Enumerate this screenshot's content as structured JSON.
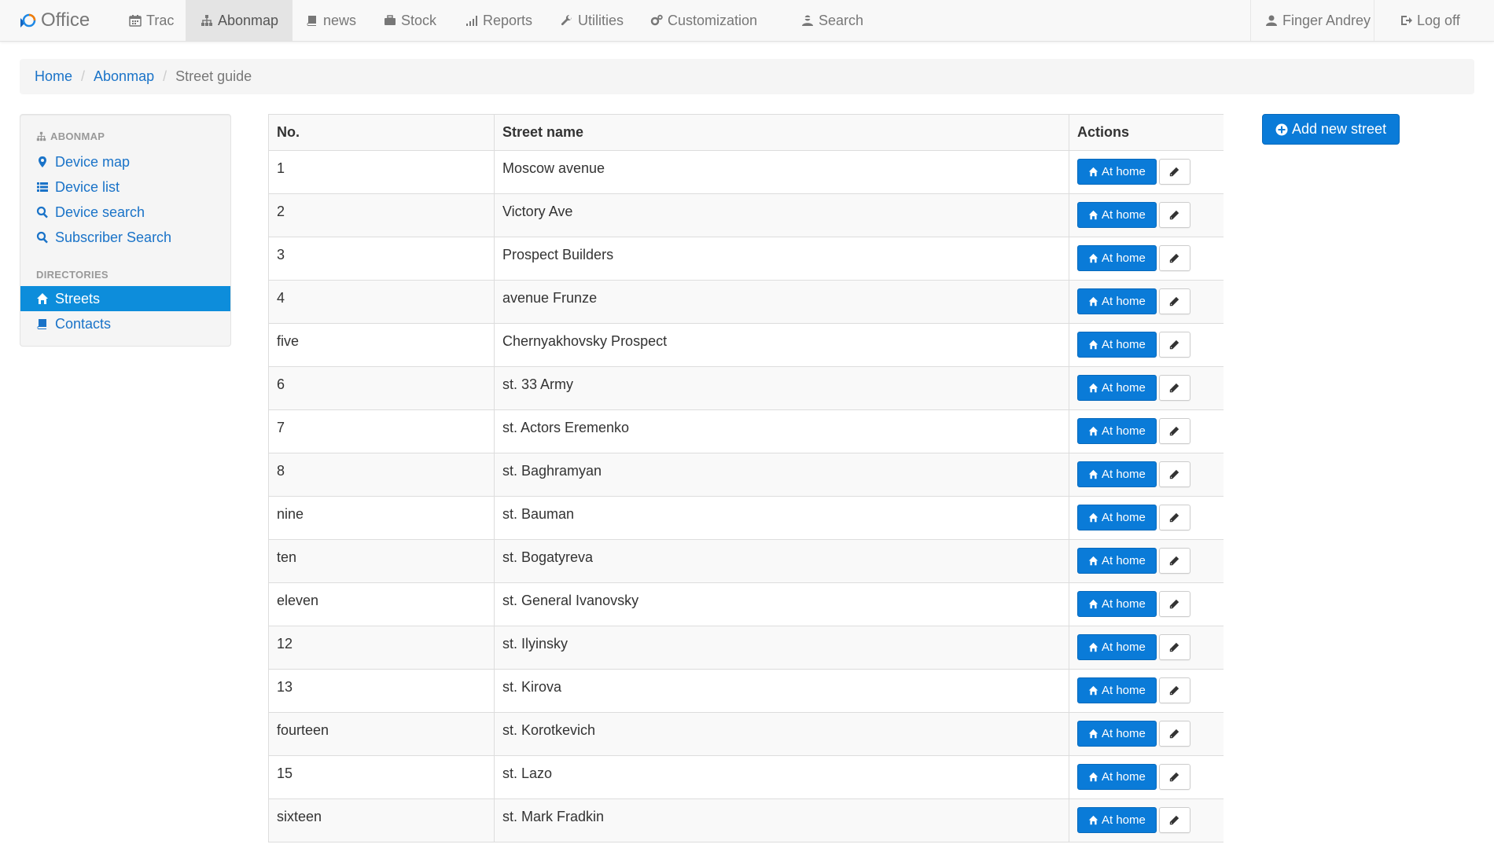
{
  "navbar": {
    "brand": "Office",
    "items": [
      {
        "label": "Trac",
        "icon": "calendar-icon"
      },
      {
        "label": "Abonmap",
        "icon": "sitemap-icon",
        "active": true
      },
      {
        "label": "news",
        "icon": "book-icon"
      },
      {
        "label": "Stock",
        "icon": "briefcase-icon"
      },
      {
        "label": "Reports",
        "icon": "signal-icon"
      },
      {
        "label": "Utilities",
        "icon": "wrench-icon"
      },
      {
        "label": "Customization",
        "icon": "cogs-icon"
      },
      {
        "label": "Search",
        "icon": "user-search-icon"
      }
    ],
    "user": "Finger Andrey",
    "logout": "Log off"
  },
  "breadcrumb": {
    "home": "Home",
    "section": "Abonmap",
    "current": "Street guide"
  },
  "sidebar": {
    "group1_header": "ABONMAP",
    "group1_items": [
      {
        "label": "Device map",
        "icon": "map-marker-icon"
      },
      {
        "label": "Device list",
        "icon": "list-icon"
      },
      {
        "label": "Device search",
        "icon": "search-icon"
      },
      {
        "label": "Subscriber Search",
        "icon": "search-icon"
      }
    ],
    "group2_header": "DIRECTORIES",
    "group2_items": [
      {
        "label": "Streets",
        "icon": "home-icon",
        "active": true
      },
      {
        "label": "Contacts",
        "icon": "book-icon"
      }
    ]
  },
  "table": {
    "headers": {
      "no": "No.",
      "street": "Street name",
      "actions": "Actions"
    },
    "at_home_label": "At home",
    "rows": [
      {
        "no": "1",
        "street": "Moscow avenue"
      },
      {
        "no": "2",
        "street": "Victory Ave"
      },
      {
        "no": "3",
        "street": "Prospect Builders"
      },
      {
        "no": "4",
        "street": "avenue Frunze"
      },
      {
        "no": "five",
        "street": "Chernyakhovsky Prospect"
      },
      {
        "no": "6",
        "street": "st. 33 Army"
      },
      {
        "no": "7",
        "street": "st. Actors Eremenko"
      },
      {
        "no": "8",
        "street": "st. Baghramyan"
      },
      {
        "no": "nine",
        "street": "st. Bauman"
      },
      {
        "no": "ten",
        "street": "st. Bogatyreva"
      },
      {
        "no": "eleven",
        "street": "st. General Ivanovsky"
      },
      {
        "no": "12",
        "street": "st. Ilyinsky"
      },
      {
        "no": "13",
        "street": "st. Kirova"
      },
      {
        "no": "fourteen",
        "street": "st. Korotkevich"
      },
      {
        "no": "15",
        "street": "st. Lazo"
      },
      {
        "no": "sixteen",
        "street": "st. Mark Fradkin"
      }
    ]
  },
  "add_button": {
    "label": "Add new street"
  },
  "colors": {
    "primary": "#0a7bd8",
    "link": "#1a73c8",
    "active_sidebar": "#0d8ddb"
  }
}
